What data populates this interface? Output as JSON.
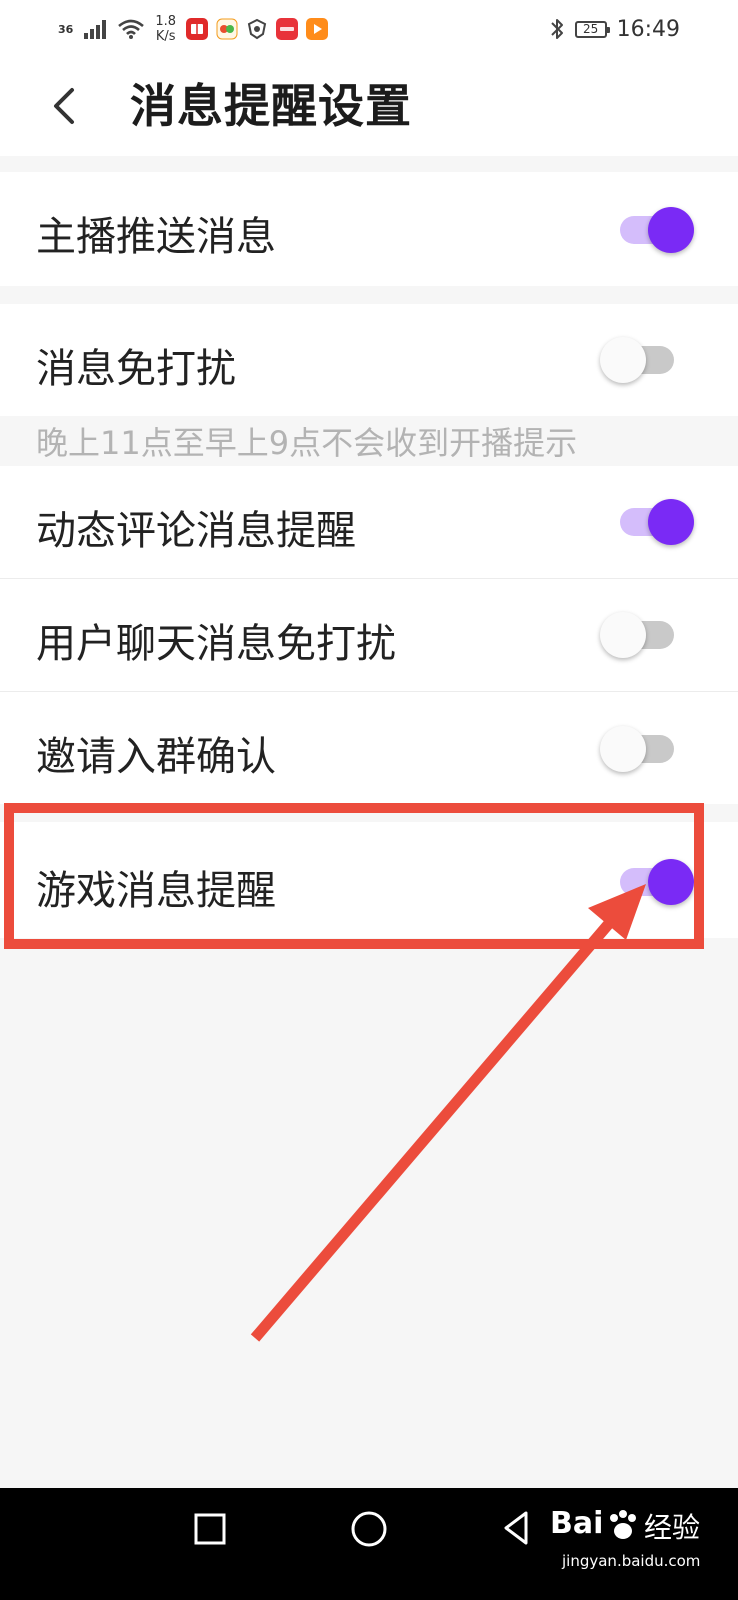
{
  "status_bar": {
    "signal_label": "36",
    "network_speed_value": "1.8",
    "network_speed_unit": "K/s",
    "battery_level": "25",
    "time": "16:49",
    "app_icons": [
      "red-book-app-icon",
      "58-app-icon",
      "shield-app-icon",
      "huawei-app-icon",
      "video-play-app-icon"
    ]
  },
  "header": {
    "title": "消息提醒设置"
  },
  "settings": [
    {
      "label": "主播推送消息",
      "enabled": true
    },
    {
      "label": "消息免打扰",
      "enabled": false
    },
    {
      "label": "动态评论消息提醒",
      "enabled": true
    },
    {
      "label": "用户聊天消息免打扰",
      "enabled": false
    },
    {
      "label": "邀请入群确认",
      "enabled": false
    },
    {
      "label": "游戏消息提醒",
      "enabled": true
    }
  ],
  "hint": "晚上11点至早上9点不会收到开播提示",
  "watermark": {
    "logo": "Bai",
    "logo_suffix": "经验",
    "domain": "jingyan.baidu.com"
  },
  "colors": {
    "accent": "#7a2af5",
    "accent_track": "#d4bdfb",
    "annotation": "#ec4c3c"
  }
}
